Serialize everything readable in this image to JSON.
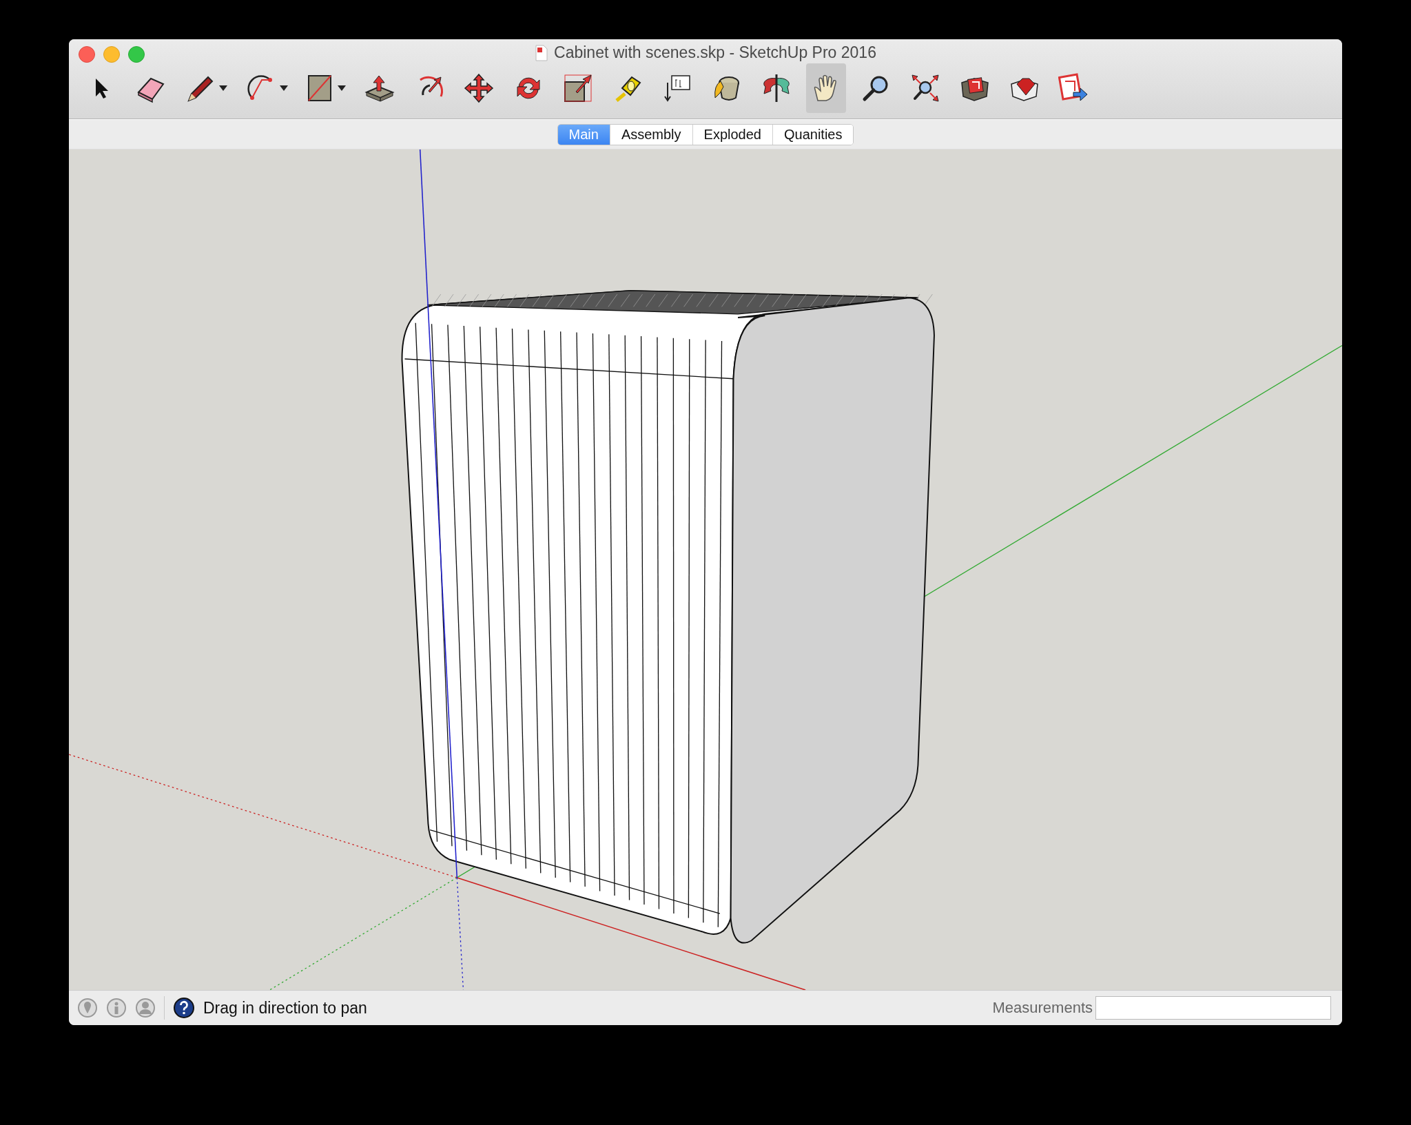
{
  "window": {
    "title": "Cabinet with scenes.skp - SketchUp Pro 2016"
  },
  "toolbar": [
    {
      "kind": "select",
      "selected": false,
      "dropdown": false
    },
    {
      "kind": "eraser",
      "selected": false,
      "dropdown": false
    },
    {
      "kind": "pencil",
      "selected": false,
      "dropdown": true
    },
    {
      "kind": "arc",
      "selected": false,
      "dropdown": true
    },
    {
      "kind": "rectangle",
      "selected": false,
      "dropdown": true
    },
    {
      "kind": "pushpull",
      "selected": false,
      "dropdown": false
    },
    {
      "kind": "offset",
      "selected": false,
      "dropdown": false
    },
    {
      "kind": "move",
      "selected": false,
      "dropdown": false
    },
    {
      "kind": "rotate",
      "selected": false,
      "dropdown": false
    },
    {
      "kind": "scale",
      "selected": false,
      "dropdown": false
    },
    {
      "kind": "tape",
      "selected": false,
      "dropdown": false
    },
    {
      "kind": "text",
      "selected": false,
      "dropdown": false
    },
    {
      "kind": "paint",
      "selected": false,
      "dropdown": false
    },
    {
      "kind": "orbit",
      "selected": false,
      "dropdown": false
    },
    {
      "kind": "pan",
      "selected": true,
      "dropdown": false
    },
    {
      "kind": "zoom",
      "selected": false,
      "dropdown": false
    },
    {
      "kind": "extents",
      "selected": false,
      "dropdown": false
    },
    {
      "kind": "warehouse",
      "selected": false,
      "dropdown": false
    },
    {
      "kind": "extension",
      "selected": false,
      "dropdown": false
    },
    {
      "kind": "layout",
      "selected": false,
      "dropdown": false
    }
  ],
  "scenes": [
    {
      "label": "Main",
      "selected": true
    },
    {
      "label": "Assembly",
      "selected": false
    },
    {
      "label": "Exploded",
      "selected": false
    },
    {
      "label": "Quanities",
      "selected": false
    }
  ],
  "status_bar": {
    "message": "Drag in direction to pan",
    "measurements_label": "Measurements"
  }
}
